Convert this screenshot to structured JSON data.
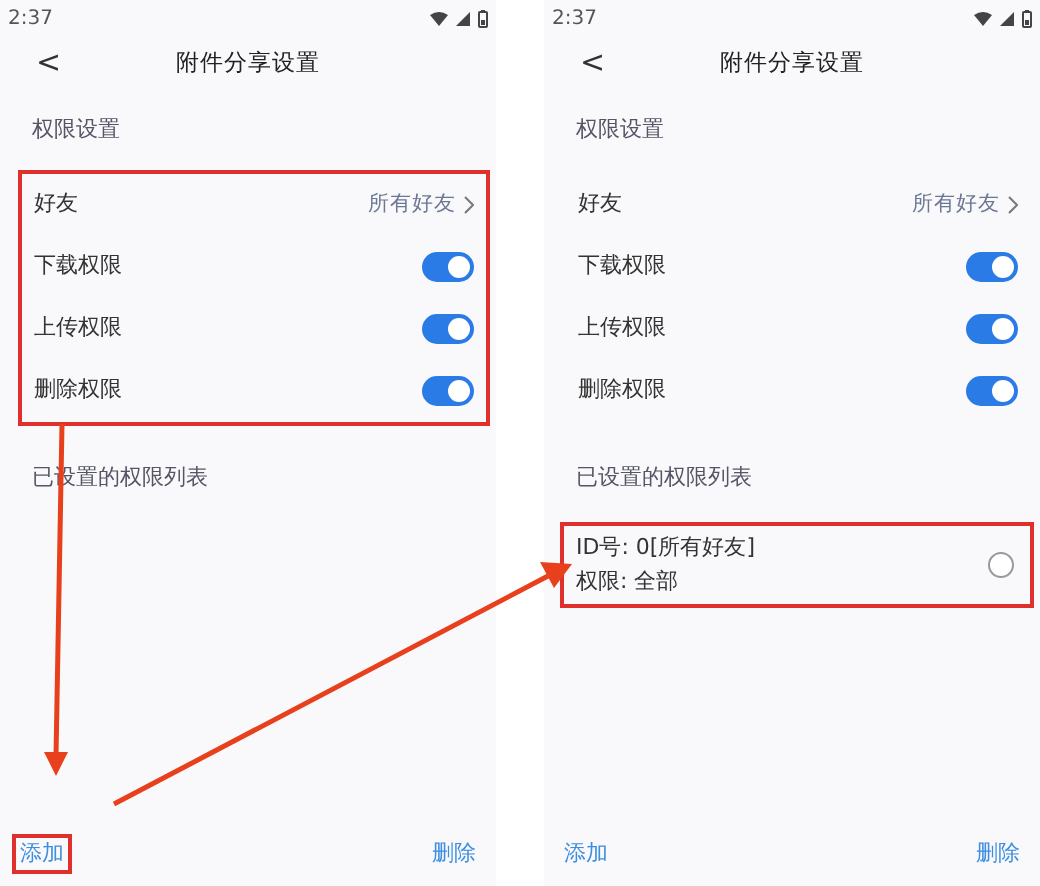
{
  "screens": [
    {
      "status_bar": {
        "time": "2:37"
      },
      "header": {
        "back": "<",
        "title": "附件分享设置"
      },
      "settings": {
        "title": "权限设置",
        "highlighted": true,
        "rows": [
          {
            "kind": "link",
            "label": "好友",
            "value": "所有好友"
          },
          {
            "kind": "toggle",
            "label": "下载权限",
            "on": true
          },
          {
            "kind": "toggle",
            "label": "上传权限",
            "on": true
          },
          {
            "kind": "toggle",
            "label": "删除权限",
            "on": true
          }
        ]
      },
      "list": {
        "title": "已设置的权限列表"
      },
      "bottom_bar": {
        "add": {
          "label": "添加",
          "highlighted": true
        },
        "delete": {
          "label": "删除"
        }
      }
    },
    {
      "status_bar": {
        "time": "2:37"
      },
      "header": {
        "back": "<",
        "title": "附件分享设置"
      },
      "settings": {
        "title": "权限设置",
        "highlighted": false,
        "rows": [
          {
            "kind": "link",
            "label": "好友",
            "value": "所有好友"
          },
          {
            "kind": "toggle",
            "label": "下载权限",
            "on": true
          },
          {
            "kind": "toggle",
            "label": "上传权限",
            "on": true
          },
          {
            "kind": "toggle",
            "label": "删除权限",
            "on": true
          }
        ]
      },
      "list": {
        "title": "已设置的权限列表",
        "items": [
          {
            "id_line": "ID号: 0[所有好友]",
            "permission_line": "权限: 全部",
            "selected": false,
            "highlighted": true
          }
        ]
      },
      "bottom_bar": {
        "add": {
          "label": "添加",
          "highlighted": false
        },
        "delete": {
          "label": "删除"
        }
      }
    }
  ]
}
